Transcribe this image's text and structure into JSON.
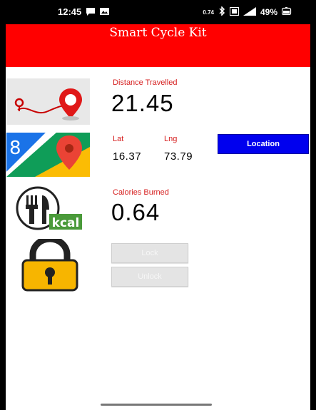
{
  "status_bar": {
    "time": "12:45",
    "data_rate": "0.74",
    "battery": "49%",
    "icons": [
      "chat-bubble-icon",
      "image-icon",
      "bluetooth-icon",
      "vo-lte-icon",
      "signal-icon",
      "battery-icon"
    ]
  },
  "app": {
    "title": "Smart Cycle Kit",
    "accent_color": "#ff0000"
  },
  "distance": {
    "label": "Distance Travelled",
    "value": "21.45",
    "icon": "route-map-icon"
  },
  "location": {
    "lat_label": "Lat",
    "lng_label": "Lng",
    "lat_value": "16.37",
    "lng_value": "73.79",
    "button_label": "Location",
    "icon": "google-maps-icon",
    "button_color": "#0000ee"
  },
  "calories": {
    "label": "Calories Burned",
    "value": "0.64",
    "icon": "fork-knife-kcal-icon",
    "kcal_badge": "kcal"
  },
  "lock": {
    "lock_label": "Lock",
    "unlock_label": "Unlock",
    "icon": "padlock-icon"
  }
}
